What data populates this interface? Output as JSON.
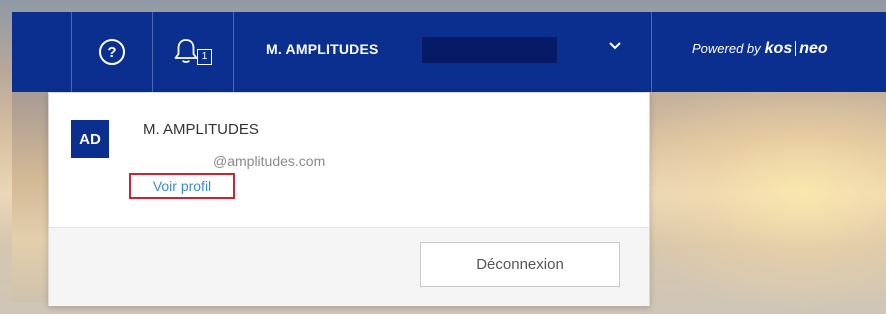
{
  "topbar": {
    "help_icon": "question-circle-icon",
    "help_glyph": "?",
    "notifications_icon": "bell-icon",
    "notification_count": "1",
    "user_name": "M. AMPLITUDES",
    "chevron_icon": "chevron-down-icon",
    "powered_by": "Powered by",
    "brand_part1": "kos",
    "brand_part2": "neo"
  },
  "dropdown": {
    "avatar_initials": "AD",
    "profile_name": "M. AMPLITUDES",
    "email_domain": "@amplitudes.com",
    "view_profile_label": "Voir profil",
    "logout_label": "Déconnexion"
  },
  "colors": {
    "brand_blue": "#0b2f8e",
    "link_blue": "#3c8dcc",
    "highlight_red": "#d32030"
  }
}
